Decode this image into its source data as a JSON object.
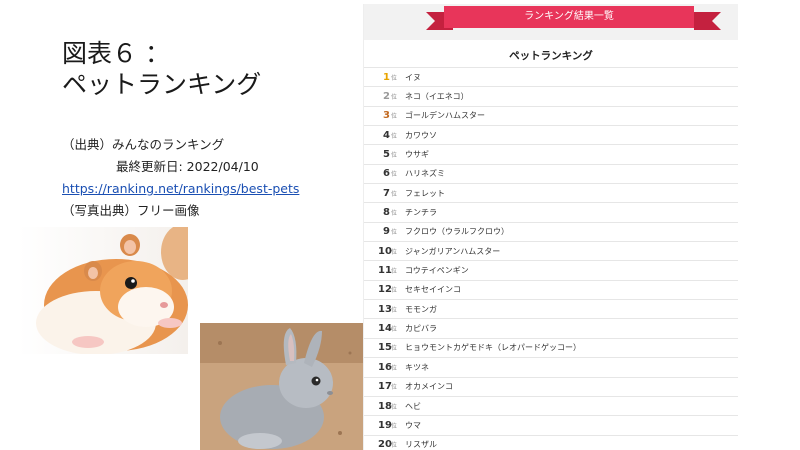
{
  "slide": {
    "title": "図表６ ：\nペットランキング",
    "source_label": "（出典）みんなのランキング",
    "updated": "最終更新日: 2022/04/10",
    "source_url": "https://ranking.net/rankings/best-pets",
    "photo_source": "（写真出典）フリー画像"
  },
  "panel": {
    "ribbon": "ランキング結果一覧",
    "subtitle": "ペットランキング",
    "rank_suffix": "位",
    "items": [
      {
        "rank": "1",
        "name": "イヌ"
      },
      {
        "rank": "2",
        "name": "ネコ（イエネコ）"
      },
      {
        "rank": "3",
        "name": "ゴールデンハムスター"
      },
      {
        "rank": "4",
        "name": "カワウソ"
      },
      {
        "rank": "5",
        "name": "ウサギ"
      },
      {
        "rank": "6",
        "name": "ハリネズミ"
      },
      {
        "rank": "7",
        "name": "フェレット"
      },
      {
        "rank": "8",
        "name": "チンチラ"
      },
      {
        "rank": "9",
        "name": "フクロウ（ウラルフクロウ）"
      },
      {
        "rank": "10",
        "name": "ジャンガリアンハムスター"
      },
      {
        "rank": "11",
        "name": "コウテイペンギン"
      },
      {
        "rank": "12",
        "name": "セキセイインコ"
      },
      {
        "rank": "13",
        "name": "モモンガ"
      },
      {
        "rank": "14",
        "name": "カピバラ"
      },
      {
        "rank": "15",
        "name": "ヒョウモントカゲモドキ（レオパードゲッコー）"
      },
      {
        "rank": "16",
        "name": "キツネ"
      },
      {
        "rank": "17",
        "name": "オカメインコ"
      },
      {
        "rank": "18",
        "name": "ヘビ"
      },
      {
        "rank": "19",
        "name": "ウマ"
      },
      {
        "rank": "20",
        "name": "リスザル"
      }
    ]
  },
  "colors": {
    "ribbon": "#e8355a",
    "gold": "#e8a400",
    "silver": "#9a9a9a",
    "bronze": "#c26a22",
    "link": "#1a4fb3"
  }
}
